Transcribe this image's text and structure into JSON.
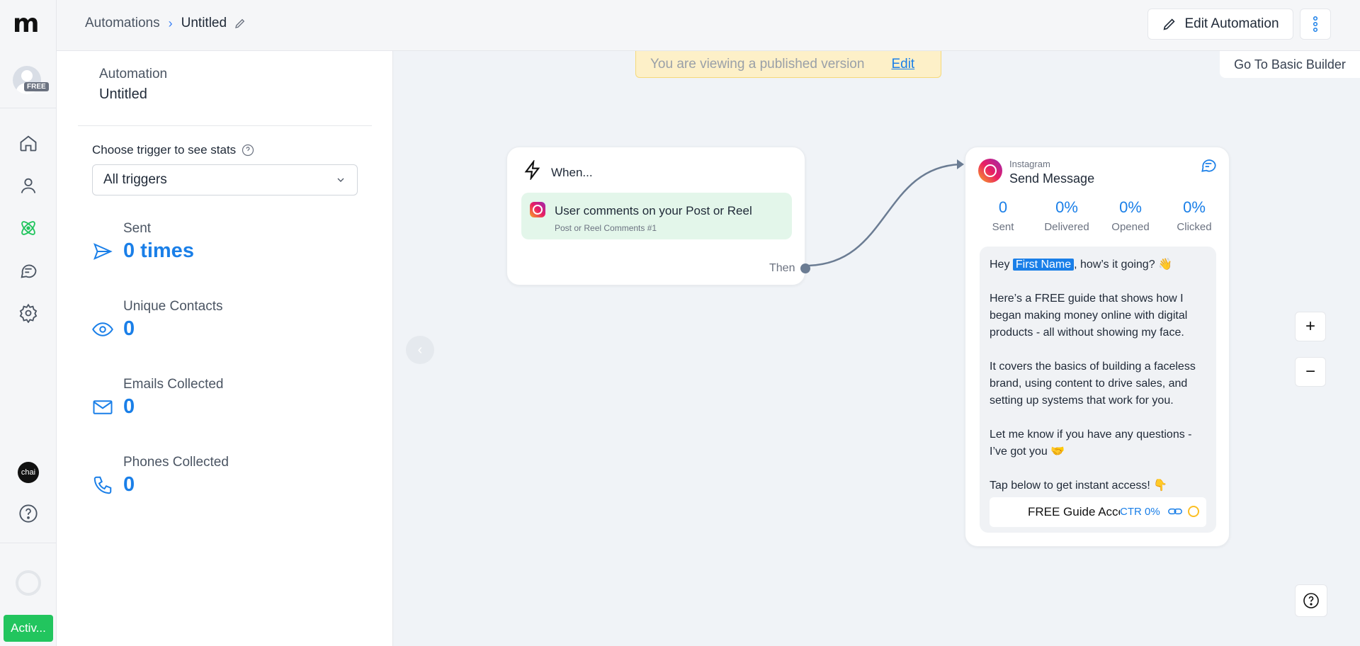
{
  "app": {
    "logo_text": "m",
    "plan_badge": "FREE",
    "chat_avatar": "chai",
    "status_button": "Activ..."
  },
  "breadcrumb": {
    "parent": "Automations",
    "current": "Untitled"
  },
  "toolbar": {
    "edit_automation": "Edit Automation",
    "basic_builder": "Go To Basic Builder"
  },
  "nav": {
    "icons": [
      "home-icon",
      "contacts-icon",
      "automations-icon",
      "chat-icon",
      "settings-icon",
      "help-icon"
    ],
    "active": "automations-icon",
    "active_color": "#22c55e"
  },
  "panel": {
    "section_label": "Automation",
    "automation_name": "Untitled",
    "trigger_label": "Choose trigger to see stats",
    "trigger_select_value": "All triggers",
    "stats": [
      {
        "label": "Sent",
        "value": "0 times",
        "icon": "send-icon"
      },
      {
        "label": "Unique Contacts",
        "value": "0",
        "icon": "eye-icon"
      },
      {
        "label": "Emails Collected",
        "value": "0",
        "icon": "mail-icon"
      },
      {
        "label": "Phones Collected",
        "value": "0",
        "icon": "phone-icon"
      }
    ]
  },
  "canvas": {
    "published_notice": "You are viewing a published version",
    "published_edit": "Edit",
    "when_node": {
      "title": "When...",
      "trigger_text": "User comments on your Post or Reel",
      "trigger_sub": "Post or Reel Comments #1",
      "then_label": "Then"
    },
    "message_node": {
      "platform": "Instagram",
      "title": "Send Message",
      "metrics": [
        {
          "value": "0",
          "label": "Sent"
        },
        {
          "value": "0%",
          "label": "Delivered"
        },
        {
          "value": "0%",
          "label": "Opened"
        },
        {
          "value": "0%",
          "label": "Clicked"
        }
      ],
      "greeting_prefix": "Hey ",
      "first_name_tag": "First Name",
      "greeting_suffix": ", how’s it going? 👋",
      "paragraph_1": "Here’s a FREE guide that shows how I began making money online with digital products - all without showing my face.",
      "paragraph_2": "It covers the basics of building a faceless brand, using content to drive sales, and setting up systems that work for you.",
      "paragraph_3": "Let me know if you have any questions - I’ve got you 🤝",
      "paragraph_4": "Tap below to get instant access! 👇",
      "cta_label": "FREE Guide Access",
      "cta_ctr": "CTR 0%"
    },
    "zoom_in": "+",
    "zoom_out": "−"
  },
  "colors": {
    "accent": "#1a7fe8",
    "trigger_bg": "#e3f6ea",
    "notice_bg": "#fdf0c8",
    "active_green": "#22c55e"
  }
}
